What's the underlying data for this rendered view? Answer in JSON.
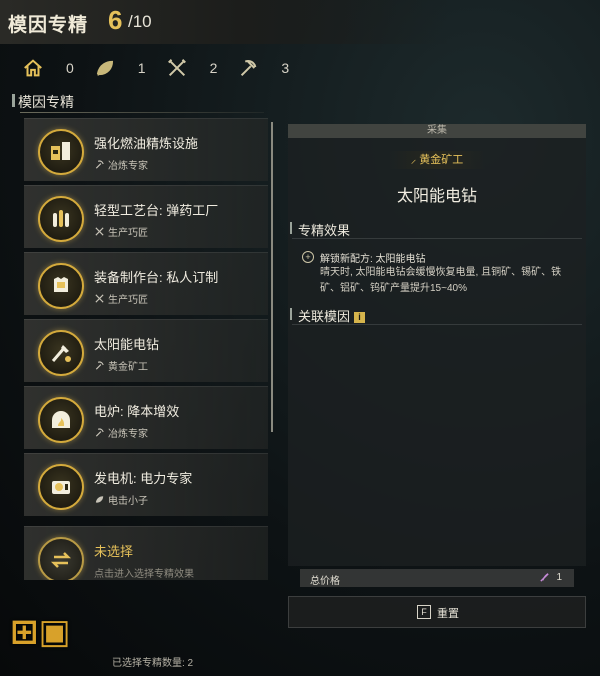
{
  "header": {
    "title": "模因专精",
    "count": "6",
    "total": "/10"
  },
  "stats": [
    {
      "icon": "house-icon",
      "value": "0"
    },
    {
      "icon": "leaf-icon",
      "value": "1"
    },
    {
      "icon": "tools-icon",
      "value": "2"
    },
    {
      "icon": "pickaxe-icon",
      "value": "3"
    }
  ],
  "list_title": "模因专精",
  "items": [
    {
      "name": "强化燃油精炼设施",
      "sub": "冶炼专家",
      "icon": "refinery-icon",
      "sub_icon": "pickaxe-icon"
    },
    {
      "name": "轻型工艺台: 弹药工厂",
      "sub": "生产巧匠",
      "icon": "ammo-icon",
      "sub_icon": "tools-icon"
    },
    {
      "name": "装备制作台: 私人订制",
      "sub": "生产巧匠",
      "icon": "armor-icon",
      "sub_icon": "tools-icon"
    },
    {
      "name": "太阳能电钻",
      "sub": "黄金矿工",
      "icon": "solar-drill-icon",
      "sub_icon": "pickaxe-icon"
    },
    {
      "name": "电炉: 降本增效",
      "sub": "冶炼专家",
      "icon": "furnace-icon",
      "sub_icon": "pickaxe-icon"
    },
    {
      "name": "发电机: 电力专家",
      "sub": "电击小子",
      "icon": "generator-icon",
      "sub_icon": "leaf-icon"
    },
    {
      "name": "未选择",
      "sub": "点击进入选择专精效果",
      "icon": "swap-icon",
      "sub_icon": ""
    }
  ],
  "detail": {
    "category": "采集",
    "badge": "黄金矿工",
    "title": "太阳能电钻",
    "effect_title": "专精效果",
    "effect_head": "解锁新配方: 太阳能电钻",
    "effect_body": "晴天时, 太阳能电钻会缓慢恢复电量, 且铜矿、锡矿、铁矿、铝矿、钨矿产量提升15~40%",
    "related_title": "关联模因"
  },
  "price": {
    "label": "总价格",
    "value": "1"
  },
  "reset": {
    "key": "F",
    "label": "重置"
  },
  "footer": "已选择专精数量: 2"
}
